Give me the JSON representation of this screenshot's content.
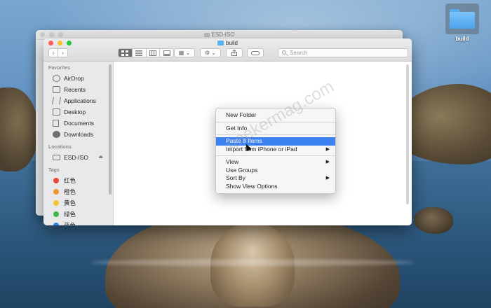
{
  "desktop": {
    "folder_label": "build"
  },
  "back_window": {
    "title": "ESD-ISO"
  },
  "window": {
    "title": "build",
    "toolbar": {
      "back_glyph": "‹",
      "forward_glyph": "›",
      "view_modes": [
        "icon-view",
        "list-view",
        "column-view",
        "gallery-view"
      ],
      "group_glyph": "▦ ⌄",
      "action_glyph": "⚙ ⌄",
      "search_placeholder": "Search"
    }
  },
  "sidebar": {
    "favorites_label": "Favorites",
    "favorites": [
      {
        "label": "AirDrop",
        "icon": "airdrop-icon"
      },
      {
        "label": "Recents",
        "icon": "recents-icon"
      },
      {
        "label": "Applications",
        "icon": "applications-icon"
      },
      {
        "label": "Desktop",
        "icon": "desktop-icon"
      },
      {
        "label": "Documents",
        "icon": "documents-icon"
      },
      {
        "label": "Downloads",
        "icon": "downloads-icon"
      }
    ],
    "locations_label": "Locations",
    "locations": [
      {
        "label": "ESD-ISO",
        "icon": "disk-icon",
        "eject": "⏏"
      }
    ],
    "tags_label": "Tags",
    "tags": [
      {
        "label": "红色",
        "color": "#e9473e"
      },
      {
        "label": "橙色",
        "color": "#f1962f"
      },
      {
        "label": "黄色",
        "color": "#f4c433"
      },
      {
        "label": "绿色",
        "color": "#3fbb4c"
      },
      {
        "label": "蓝色",
        "color": "#3580ed"
      }
    ]
  },
  "context_menu": {
    "items": [
      {
        "label": "New Folder"
      },
      {
        "label": "Get Info"
      },
      {
        "label": "Paste 8 Items",
        "highlighted": true
      },
      {
        "label": "Import from iPhone or iPad",
        "submenu": "▶"
      },
      {
        "label": "View",
        "submenu": "▶"
      },
      {
        "label": "Use Groups"
      },
      {
        "label": "Sort By",
        "submenu": "▶"
      },
      {
        "label": "Show View Options"
      }
    ]
  },
  "watermark": "geekermag.com",
  "colors": {
    "accent": "#3b82f0",
    "close": "#fc5f57",
    "minimize": "#fdbc2e",
    "zoom": "#28c840"
  }
}
